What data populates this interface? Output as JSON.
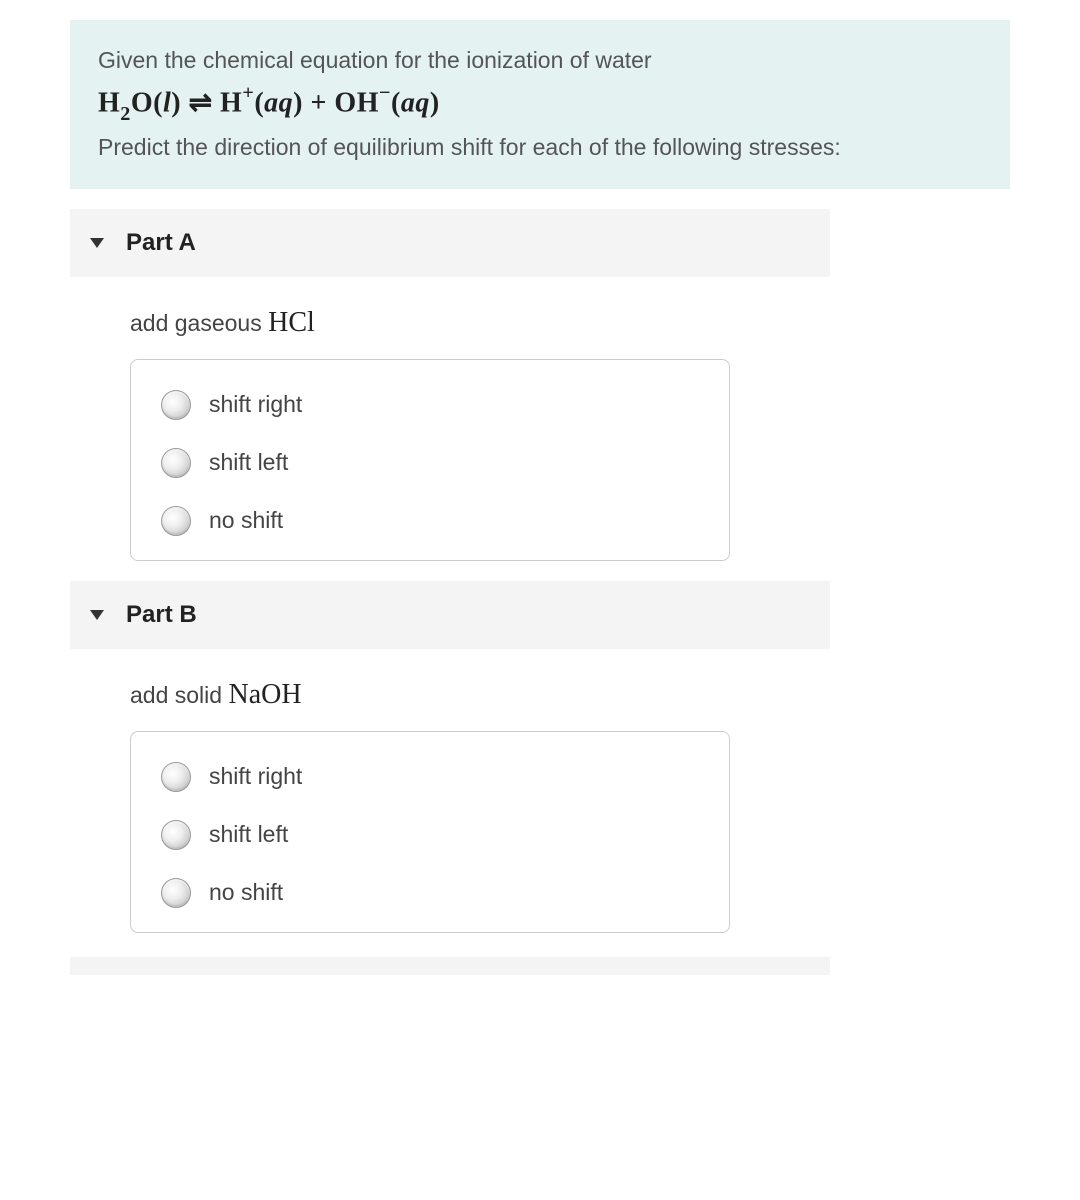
{
  "intro": {
    "line1": "Given the chemical equation for the ionization of water",
    "line2": "Predict the direction of equilibrium shift for each of the following stresses:"
  },
  "parts": [
    {
      "title": "Part A",
      "prompt_prefix": "add gaseous ",
      "prompt_chem": "HCl",
      "options": [
        "shift right",
        "shift left",
        "no shift"
      ]
    },
    {
      "title": "Part B",
      "prompt_prefix": "add solid ",
      "prompt_chem": "NaOH",
      "options": [
        "shift right",
        "shift left",
        "no shift"
      ]
    }
  ]
}
